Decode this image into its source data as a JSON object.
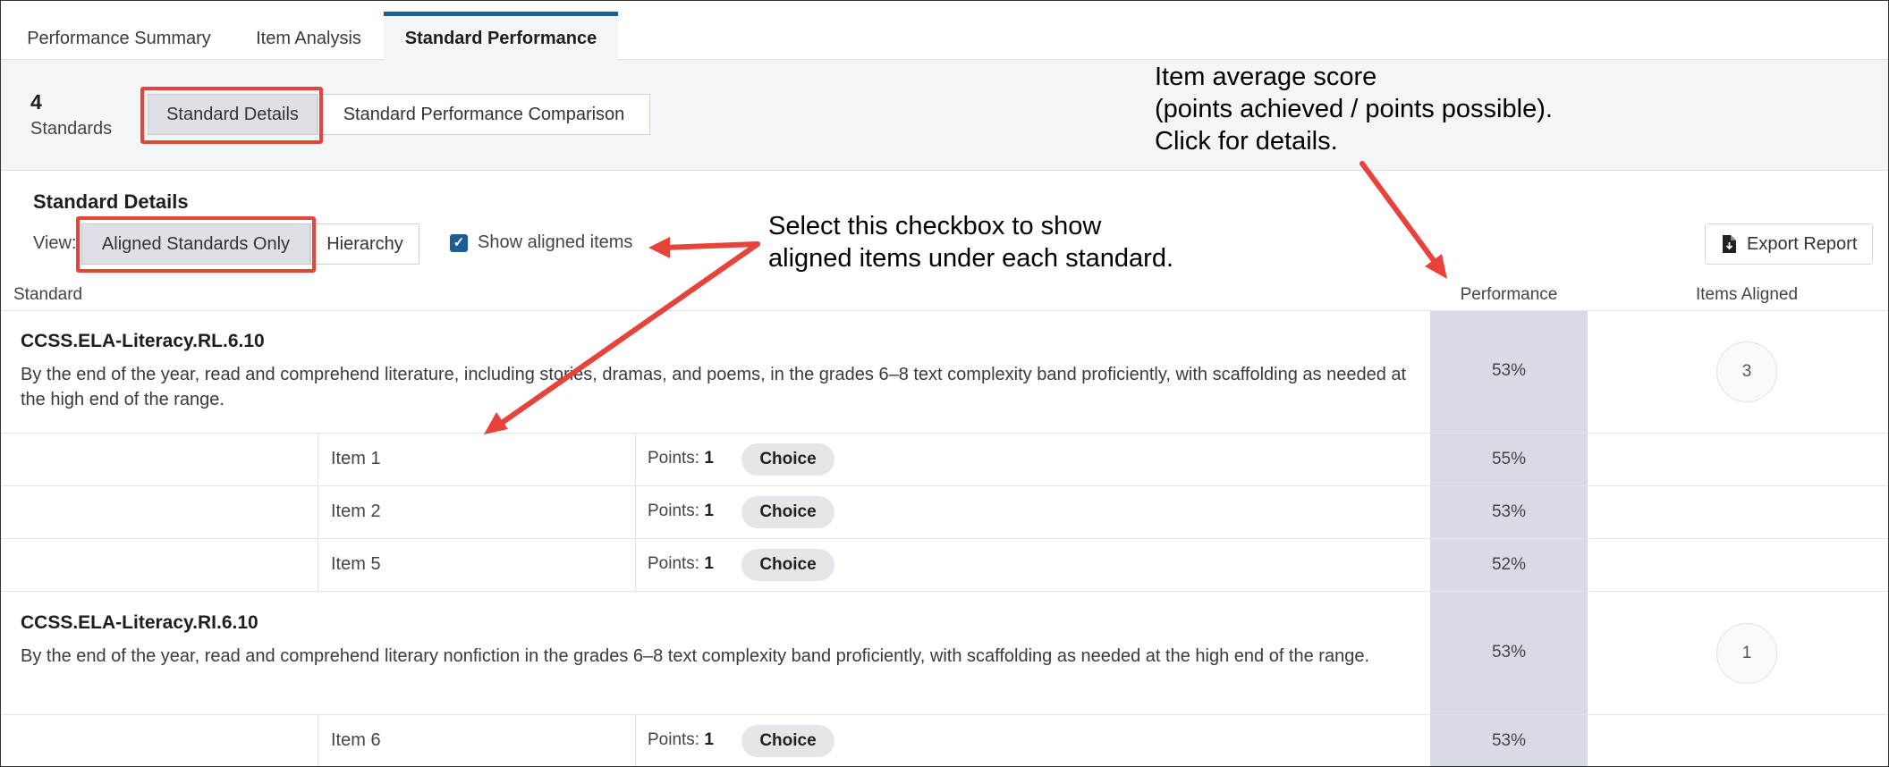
{
  "tabs": [
    "Performance Summary",
    "Item Analysis",
    "Standard Performance"
  ],
  "summary": {
    "count": "4",
    "count_label": "Standards",
    "toggle_details": "Standard Details",
    "toggle_comparison": "Standard Performance Comparison"
  },
  "details": {
    "title": "Standard Details",
    "view_label": "View:",
    "view_aligned": "Aligned Standards Only",
    "view_hierarchy": "Hierarchy",
    "checkbox_label": "Show aligned items",
    "export_label": "Export Report"
  },
  "columns": {
    "standard": "Standard",
    "performance": "Performance",
    "items_aligned": "Items Aligned"
  },
  "standards": [
    {
      "code": "CCSS.ELA-Literacy.RL.6.10",
      "description": "By the end of the year, read and comprehend literature, including stories, dramas, and poems, in the grades 6–8 text complexity band proficiently, with scaffolding as needed at the high end of the range.",
      "performance": "53%",
      "items_aligned": "3",
      "items": [
        {
          "name": "Item 1",
          "points_label": "Points:",
          "points": "1",
          "type": "Choice",
          "performance": "55%"
        },
        {
          "name": "Item 2",
          "points_label": "Points:",
          "points": "1",
          "type": "Choice",
          "performance": "53%"
        },
        {
          "name": "Item 5",
          "points_label": "Points:",
          "points": "1",
          "type": "Choice",
          "performance": "52%"
        }
      ]
    },
    {
      "code": "CCSS.ELA-Literacy.RI.6.10",
      "description": "By the end of the year, read and comprehend literary nonfiction in the grades 6–8 text complexity band proficiently, with scaffolding as needed at the high end of the range.",
      "performance": "53%",
      "items_aligned": "1",
      "items": [
        {
          "name": "Item 6",
          "points_label": "Points:",
          "points": "1",
          "type": "Choice",
          "performance": "53%"
        }
      ]
    }
  ],
  "annotations": {
    "performance_note": [
      "Item average score",
      "(points achieved / points possible).",
      "Click for details."
    ],
    "checkbox_note": [
      "Select this checkbox to show",
      "aligned items under each standard."
    ]
  },
  "colors": {
    "tab_accent": "#1d5c94",
    "highlight": "#e8433a",
    "performance_column": "#d9dae5",
    "checkbox": "#1d5c94"
  },
  "icons": [
    "check-icon",
    "export-file-icon"
  ]
}
